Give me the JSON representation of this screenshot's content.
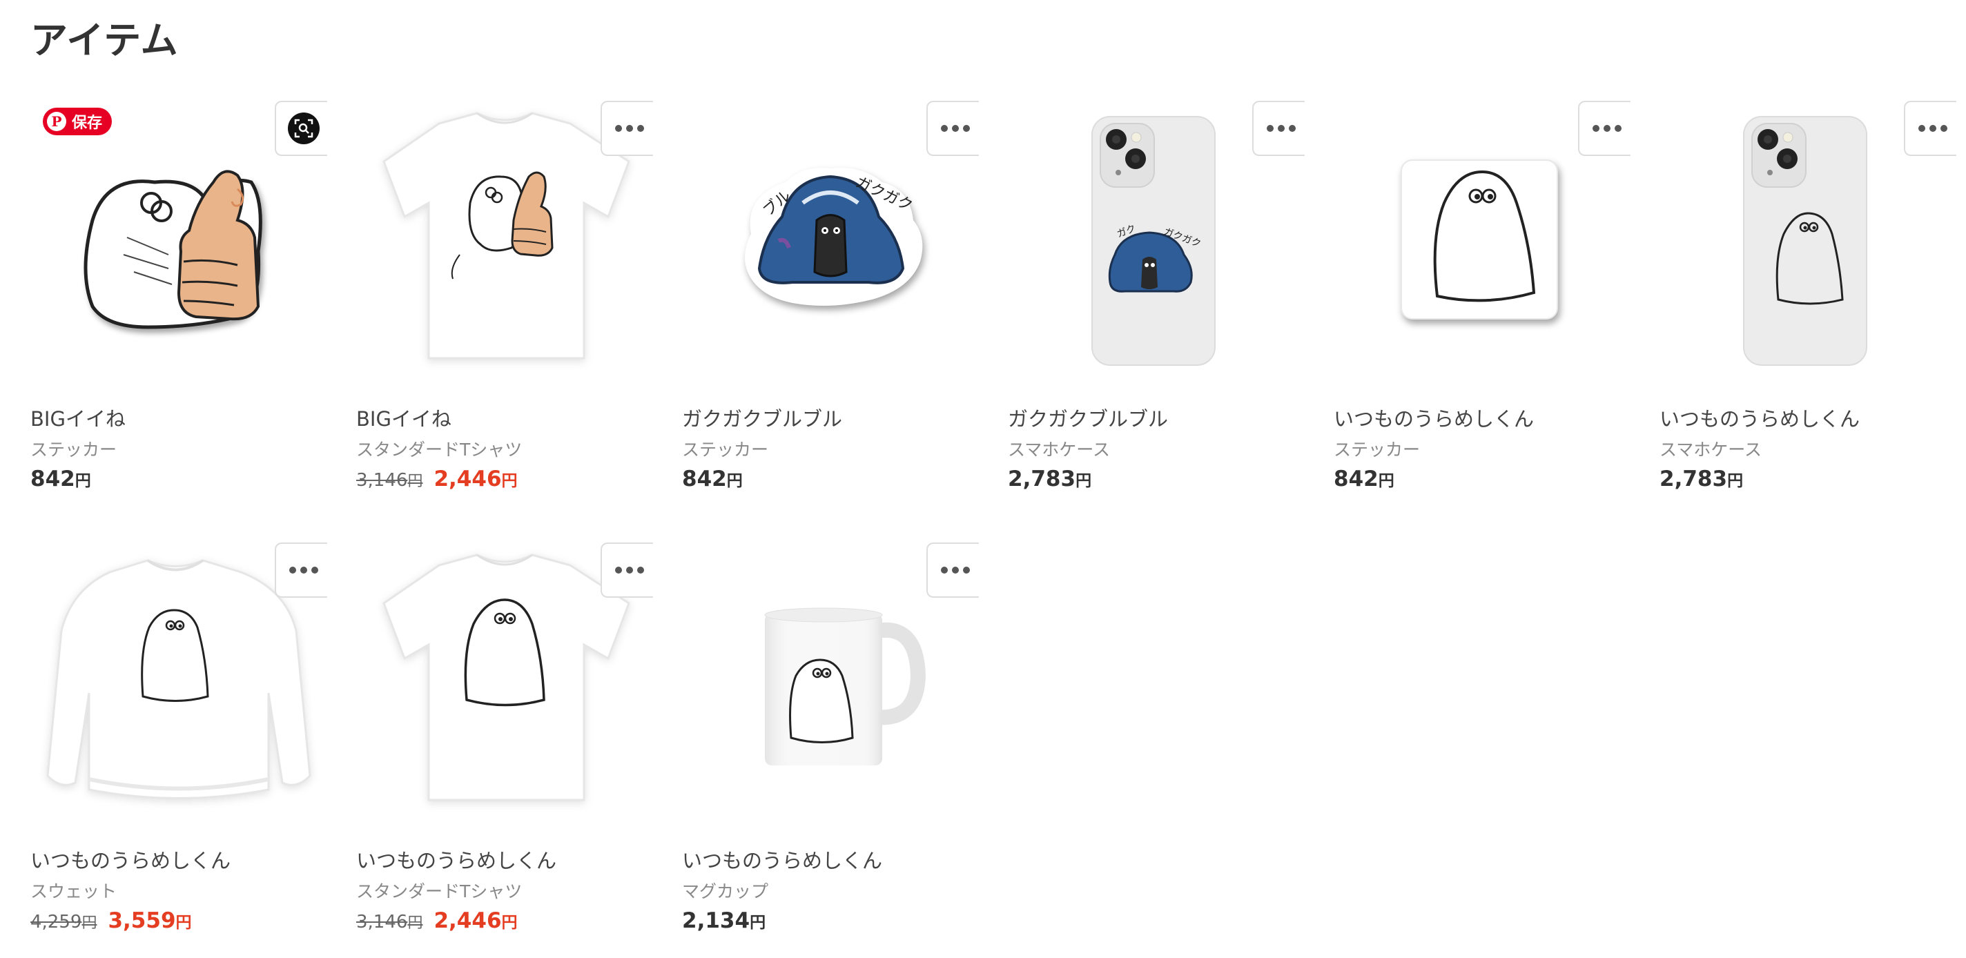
{
  "section_title": "アイテム",
  "colors": {
    "sale": "#e43d22",
    "pinterest": "#e60023",
    "text": "#333333",
    "muted": "#888888"
  },
  "pin_save_label": "保存",
  "yen": "円",
  "items": [
    {
      "name": "BIGイイね",
      "type": "ステッカー",
      "price": "842",
      "old_price": null,
      "image": "big-iine-sticker"
    },
    {
      "name": "BIGイイね",
      "type": "スタンダードTシャツ",
      "price": "2,446",
      "old_price": "3,146",
      "image": "big-iine-tshirt"
    },
    {
      "name": "ガクガクブルブル",
      "type": "ステッカー",
      "price": "842",
      "old_price": null,
      "image": "gakugaku-sticker"
    },
    {
      "name": "ガクガクブルブル",
      "type": "スマホケース",
      "price": "2,783",
      "old_price": null,
      "image": "gakugaku-phonecase"
    },
    {
      "name": "いつものうらめしくん",
      "type": "ステッカー",
      "price": "842",
      "old_price": null,
      "image": "urameshi-sticker"
    },
    {
      "name": "いつものうらめしくん",
      "type": "スマホケース",
      "price": "2,783",
      "old_price": null,
      "image": "urameshi-phonecase"
    },
    {
      "name": "いつものうらめしくん",
      "type": "スウェット",
      "price": "3,559",
      "old_price": "4,259",
      "image": "urameshi-sweat"
    },
    {
      "name": "いつものうらめしくん",
      "type": "スタンダードTシャツ",
      "price": "2,446",
      "old_price": "3,146",
      "image": "urameshi-tshirt"
    },
    {
      "name": "いつものうらめしくん",
      "type": "マグカップ",
      "price": "2,134",
      "old_price": null,
      "image": "urameshi-mug"
    }
  ]
}
